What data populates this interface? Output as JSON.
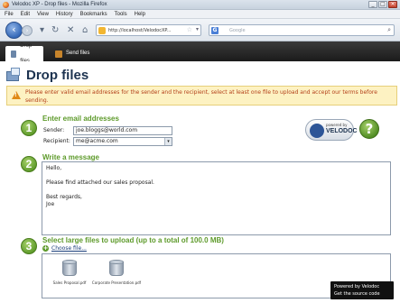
{
  "window": {
    "title": "Velodoc XP - Drop files - Mozilla Firefox",
    "buttons": [
      "_",
      "□",
      "×"
    ]
  },
  "menu": [
    "File",
    "Edit",
    "View",
    "History",
    "Bookmarks",
    "Tools",
    "Help"
  ],
  "navbar": {
    "url": "http://localhost/VelodocXP...",
    "search_placeholder": "Google",
    "search_engine_icon": "G"
  },
  "tabs": [
    {
      "label": "Drop files",
      "active": true
    },
    {
      "label": "Send files",
      "active": false
    }
  ],
  "page": {
    "title": "Drop files",
    "warning": "Please enter valid email addresses for the sender and the recipient, select at least one file to upload and accept our terms before sending.",
    "steps": {
      "s1": {
        "num": "1",
        "title": "Enter email addresses"
      },
      "s2": {
        "num": "2",
        "title": "Write a message"
      },
      "s3": {
        "num": "3",
        "title": "Select large files to upload (up to a total of 100.0 MB)"
      }
    },
    "sender_label": "Sender:",
    "sender_value": "joe.bloggs@world.com",
    "recipient_label": "Recipient:",
    "recipient_value": "me@acme.com",
    "message": "Hello,\n\nPlease find attached our sales proposal.\n\nBest regards,\nJoe",
    "choose_file": "Choose file...",
    "files": [
      {
        "name": "Sales Proposal.pdf"
      },
      {
        "name": "Corporate Presentation.pdf"
      }
    ],
    "powered": {
      "small": "powered by",
      "brand": "VELODOC"
    },
    "help_symbol": "?",
    "tooltip_line1": "Powered by Velodoc",
    "tooltip_line2": "Get the source code"
  }
}
